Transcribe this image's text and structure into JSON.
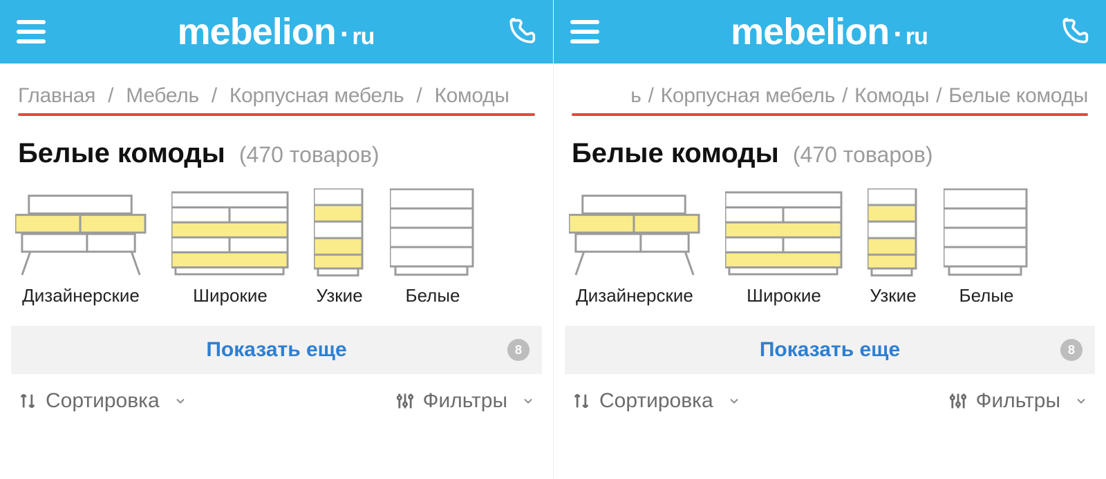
{
  "header": {
    "logo_main": "mebelion",
    "logo_suffix": "ru"
  },
  "panes": [
    {
      "breadcrumbs": [
        "Главная",
        "Мебель",
        "Корпусная мебель",
        "Комоды"
      ],
      "breadcrumb_align": "left",
      "title": "Белые комоды",
      "count_text": "(470 товаров)",
      "thumbs": [
        "Дизайнерские",
        "Широкие",
        "Узкие",
        "Белые"
      ],
      "showmore_label": "Показать еще",
      "showmore_badge": "8",
      "sort_label": "Сортировка",
      "filter_label": "Фильтры"
    },
    {
      "breadcrumbs": [
        "ь",
        "Корпусная мебель",
        "Комоды",
        "Белые комоды"
      ],
      "breadcrumb_align": "right",
      "title": "Белые комоды",
      "count_text": "(470 товаров)",
      "thumbs": [
        "Дизайнерские",
        "Широкие",
        "Узкие",
        "Белые"
      ],
      "showmore_label": "Показать еще",
      "showmore_badge": "8",
      "sort_label": "Сортировка",
      "filter_label": "Фильтры"
    }
  ],
  "colors": {
    "header_bg": "#33b5e8",
    "accent_underline": "#e34a40",
    "link_blue": "#2d7fd3",
    "grey_text": "#9b9b9b",
    "dresser_yellow": "#faec8b",
    "dresser_stroke": "#9b9b9b"
  }
}
